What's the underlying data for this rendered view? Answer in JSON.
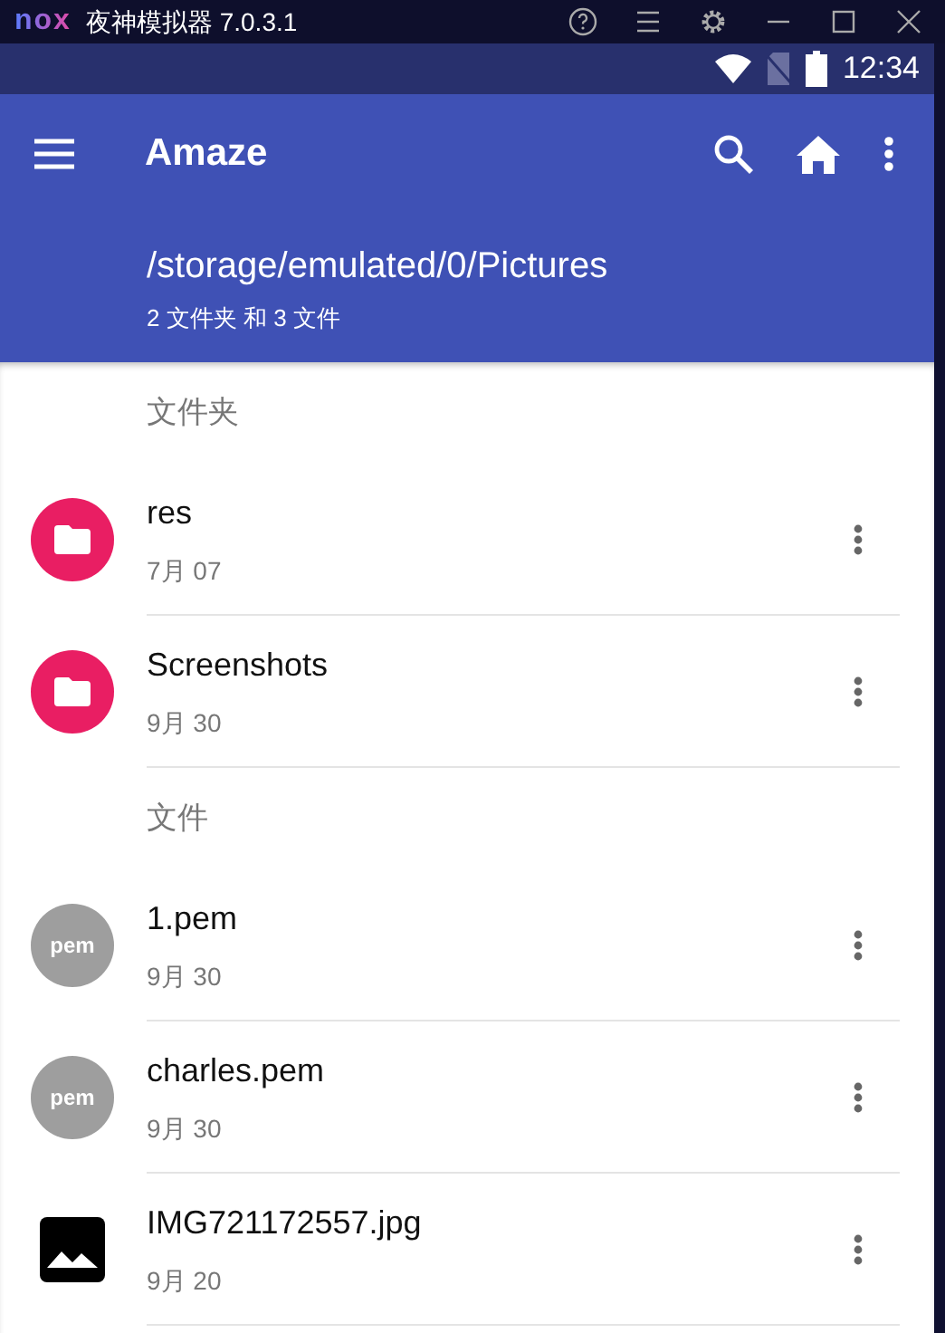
{
  "emulator": {
    "logo": "nox",
    "title": "夜神模拟器 7.0.3.1"
  },
  "status_bar": {
    "time": "12:34"
  },
  "app_bar": {
    "title": "Amaze",
    "path": "/storage/emulated/0/Pictures",
    "summary": "2 文件夹 和 3 文件"
  },
  "sections": [
    {
      "header": "文件夹",
      "items": [
        {
          "kind": "folder",
          "name": "res",
          "date": "7月 07"
        },
        {
          "kind": "folder",
          "name": "Screenshots",
          "date": "9月 30"
        }
      ]
    },
    {
      "header": "文件",
      "items": [
        {
          "kind": "file",
          "badge": "pem",
          "name": "1.pem",
          "date": "9月 30"
        },
        {
          "kind": "file",
          "badge": "pem",
          "name": "charles.pem",
          "date": "9月 30"
        },
        {
          "kind": "image",
          "name": "IMG721172557.jpg",
          "date": "9月 20"
        }
      ]
    }
  ]
}
